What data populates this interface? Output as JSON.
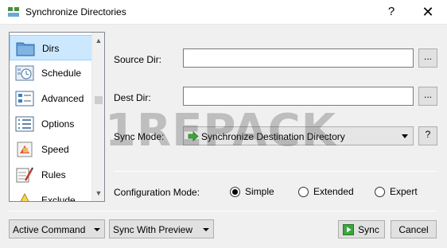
{
  "window": {
    "title": "Synchronize Directories",
    "help_glyph": "?",
    "close_glyph": "✕"
  },
  "nav": {
    "items": [
      {
        "label": "Dirs",
        "icon": "folder-icon",
        "selected": true
      },
      {
        "label": "Schedule",
        "icon": "schedule-icon"
      },
      {
        "label": "Advanced",
        "icon": "advanced-icon"
      },
      {
        "label": "Options",
        "icon": "options-icon"
      },
      {
        "label": "Speed",
        "icon": "speed-icon"
      },
      {
        "label": "Rules",
        "icon": "rules-icon"
      },
      {
        "label": "Exclude",
        "icon": "exclude-icon"
      }
    ],
    "scroll_up": "▲",
    "scroll_down": "▼"
  },
  "form": {
    "source_label": "Source Dir:",
    "source_value": "",
    "dest_label": "Dest Dir:",
    "dest_value": "",
    "browse_label": "...",
    "sync_mode_label": "Sync Mode:",
    "sync_mode_value": "Synchronize Destination Directory",
    "sync_help": "?",
    "config_label": "Configuration Mode:",
    "config_options": [
      {
        "label": "Simple",
        "checked": true
      },
      {
        "label": "Extended",
        "checked": false
      },
      {
        "label": "Expert",
        "checked": false
      }
    ]
  },
  "footer": {
    "active_command": "Active Command",
    "sync_preview": "Sync With Preview",
    "sync_button": "Sync",
    "cancel_button": "Cancel"
  },
  "watermark": "1REPACK",
  "colors": {
    "selection": "#cce8ff",
    "window_bg": "#f0f0f0",
    "play_green": "#3ca63c"
  }
}
